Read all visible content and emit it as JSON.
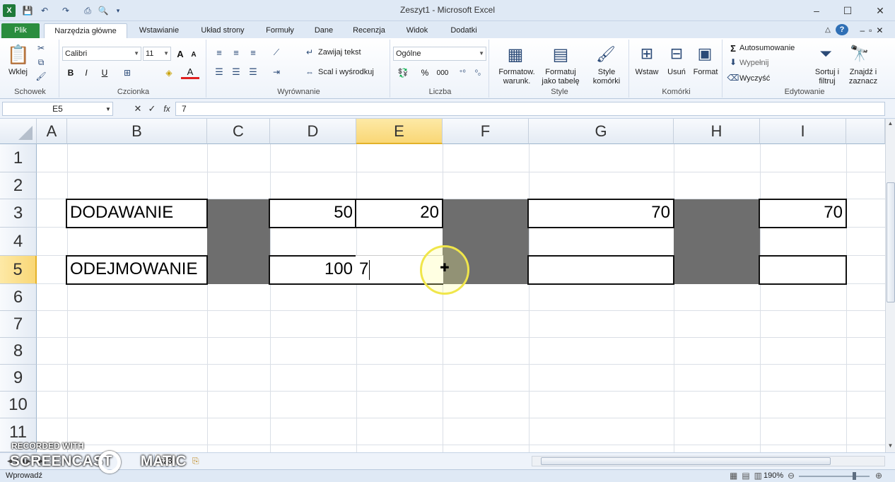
{
  "window": {
    "title": "Zeszyt1  -  Microsoft Excel",
    "minimize": "–",
    "maximize": "☐",
    "close": "✕"
  },
  "ribbon_tabs": [
    {
      "label": "Plik"
    },
    {
      "label": "Narzędzia główne"
    },
    {
      "label": "Wstawianie"
    },
    {
      "label": "Układ strony"
    },
    {
      "label": "Formuły"
    },
    {
      "label": "Dane"
    },
    {
      "label": "Recenzja"
    },
    {
      "label": "Widok"
    },
    {
      "label": "Dodatki"
    }
  ],
  "ribbon": {
    "clipboard": {
      "paste": "Wklej",
      "group": "Schowek"
    },
    "font": {
      "name": "Calibri",
      "size": "11",
      "bold": "B",
      "italic": "I",
      "underline": "U",
      "grow": "A",
      "shrink": "A",
      "color_a": "A",
      "group": "Czcionka"
    },
    "alignment": {
      "wrap": "Zawijaj tekst",
      "merge": "Scal i wyśrodkuj",
      "group": "Wyrównanie"
    },
    "number": {
      "format": "Ogólne",
      "percent": "%",
      "thousands": "000",
      "group": "Liczba"
    },
    "styles": {
      "cond_line1": "Formatow.",
      "cond_line2": "warunk.",
      "table_line1": "Formatuj",
      "table_line2": "jako tabelę",
      "cell_line1": "Style",
      "cell_line2": "komórki",
      "group": "Style"
    },
    "cells": {
      "insert": "Wstaw",
      "delete": "Usuń",
      "format": "Format",
      "group": "Komórki"
    },
    "editing": {
      "autosum": "Autosumowanie",
      "fill": "Wypełnij",
      "clear": "Wyczyść",
      "sort_line1": "Sortuj i",
      "sort_line2": "filtruj",
      "find_line1": "Znajdź i",
      "find_line2": "zaznacz",
      "group": "Edytowanie"
    }
  },
  "formula_bar": {
    "name_box": "E5",
    "fx": "fx",
    "cancel": "✕",
    "enter": "✓",
    "content": "7"
  },
  "columns": [
    "A",
    "B",
    "C",
    "D",
    "E",
    "F",
    "G",
    "H",
    "I"
  ],
  "rows": [
    "1",
    "2",
    "3",
    "4",
    "5",
    "6",
    "7",
    "8",
    "9",
    "10",
    "11"
  ],
  "cells": {
    "B3": "DODAWANIE",
    "D3": "50",
    "E3": "20",
    "G3": "70",
    "I3": "70",
    "B5": "ODEJMOWANIE",
    "D5": "100",
    "E5_edit": "7"
  },
  "sheet_tabs": {
    "sheet3": "sz3"
  },
  "status": {
    "mode": "Wprowadź",
    "zoom": "190%",
    "zoom_minus": "⊖",
    "zoom_plus": "⊕"
  },
  "watermark": {
    "line1": "RECORDED WITH",
    "line2": "SCREENCAST",
    "line3": "MATIC"
  }
}
